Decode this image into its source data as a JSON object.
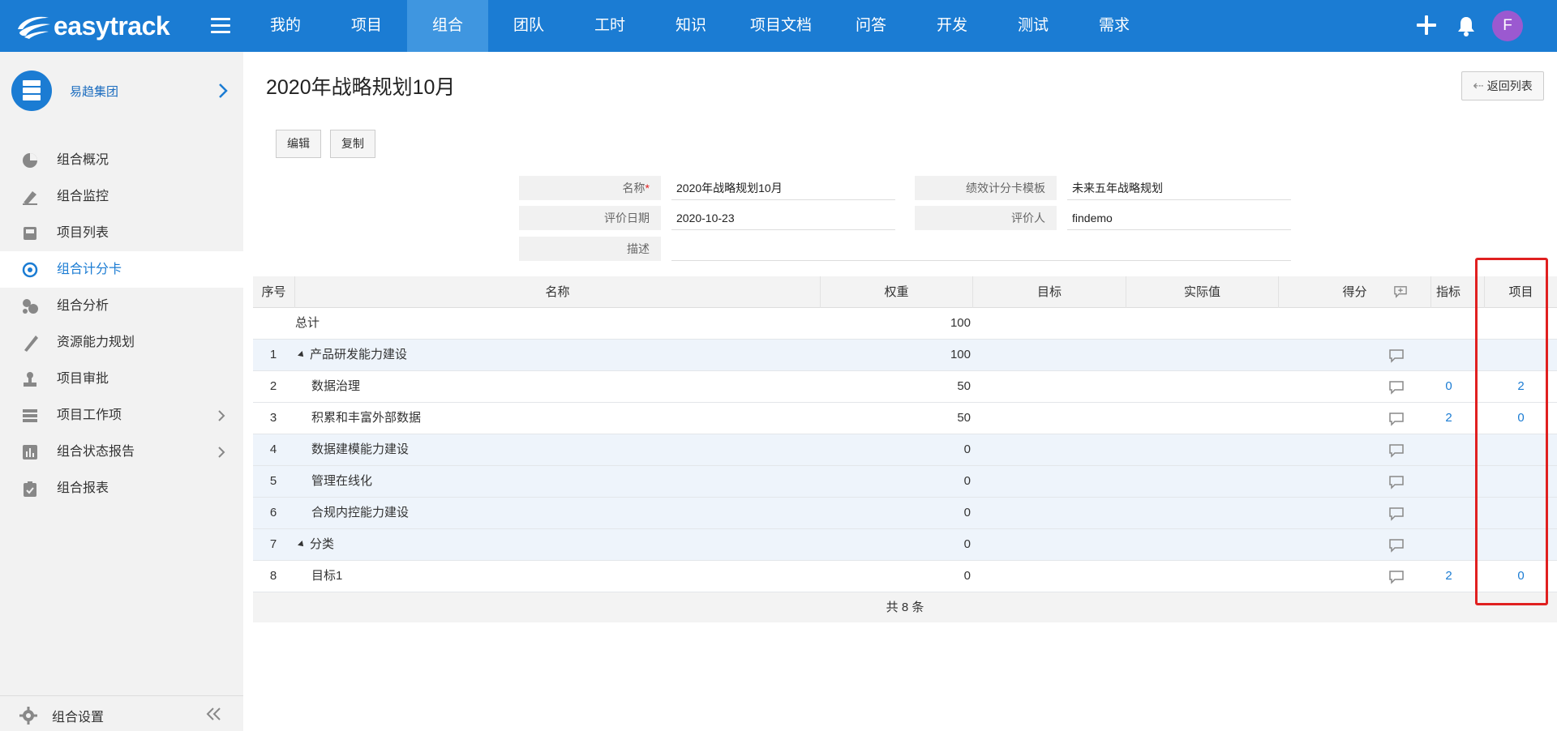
{
  "app": {
    "logo_text": "easytrack"
  },
  "nav": {
    "items": [
      {
        "label": "我的",
        "width": 100
      },
      {
        "label": "项目",
        "width": 100
      },
      {
        "label": "组合",
        "width": 100,
        "active": true
      },
      {
        "label": "团队",
        "width": 100
      },
      {
        "label": "工时",
        "width": 100
      },
      {
        "label": "知识",
        "width": 100
      },
      {
        "label": "项目文档",
        "width": 122
      },
      {
        "label": "问答",
        "width": 100
      },
      {
        "label": "开发",
        "width": 100
      },
      {
        "label": "测试",
        "width": 100
      },
      {
        "label": "需求",
        "width": 100
      }
    ],
    "avatar_letter": "F"
  },
  "sidebar": {
    "org_name": "易趋集团",
    "items": [
      {
        "label": "组合概况",
        "icon": "pie-chart-icon"
      },
      {
        "label": "组合监控",
        "icon": "monitor-icon"
      },
      {
        "label": "项目列表",
        "icon": "inbox-icon"
      },
      {
        "label": "组合计分卡",
        "icon": "target-icon",
        "active": true
      },
      {
        "label": "组合分析",
        "icon": "analysis-icon"
      },
      {
        "label": "资源能力规划",
        "icon": "ruler-icon"
      },
      {
        "label": "项目审批",
        "icon": "stamp-icon"
      },
      {
        "label": "项目工作项",
        "icon": "list-icon",
        "chevron": true
      },
      {
        "label": "组合状态报告",
        "icon": "bar-chart-icon",
        "chevron": true
      },
      {
        "label": "组合报表",
        "icon": "clipboard-icon"
      }
    ],
    "settings_label": "组合设置"
  },
  "page": {
    "title": "2020年战略规划10月",
    "back_label": "返回列表",
    "edit_label": "编辑",
    "copy_label": "复制"
  },
  "form": {
    "name_label": "名称",
    "name_required_mark": "*",
    "name_value": "2020年战略规划10月",
    "template_label": "绩效计分卡模板",
    "template_value": "未来五年战略规划",
    "date_label": "评价日期",
    "date_value": "2020-10-23",
    "evaluator_label": "评价人",
    "evaluator_value": "findemo",
    "desc_label": "描述",
    "desc_value": ""
  },
  "table": {
    "headers": {
      "index": "序号",
      "name": "名称",
      "weight": "权重",
      "target": "目标",
      "actual": "实际值",
      "score": "得分",
      "indicator": "指标",
      "project": "项目"
    },
    "total": {
      "name": "总计",
      "weight": "100"
    },
    "rows": [
      {
        "index": "1",
        "name": "产品研发能力建设",
        "weight": "100",
        "indicator": "",
        "project": "",
        "expandable": true,
        "blue": true
      },
      {
        "index": "2",
        "name": "数据治理",
        "weight": "50",
        "indicator": "0",
        "project": "2",
        "blue": false
      },
      {
        "index": "3",
        "name": "积累和丰富外部数据",
        "weight": "50",
        "indicator": "2",
        "project": "0",
        "blue": false
      },
      {
        "index": "4",
        "name": "数据建模能力建设",
        "weight": "0",
        "indicator": "",
        "project": "",
        "blue": true
      },
      {
        "index": "5",
        "name": "管理在线化",
        "weight": "0",
        "indicator": "",
        "project": "",
        "blue": true
      },
      {
        "index": "6",
        "name": "合规内控能力建设",
        "weight": "0",
        "indicator": "",
        "project": "",
        "blue": true
      },
      {
        "index": "7",
        "name": "分类",
        "weight": "0",
        "indicator": "",
        "project": "",
        "expandable": true,
        "blue": true
      },
      {
        "index": "8",
        "name": "目标1",
        "weight": "0",
        "indicator": "2",
        "project": "0",
        "blue": false
      }
    ],
    "footer": "共 8 条"
  }
}
